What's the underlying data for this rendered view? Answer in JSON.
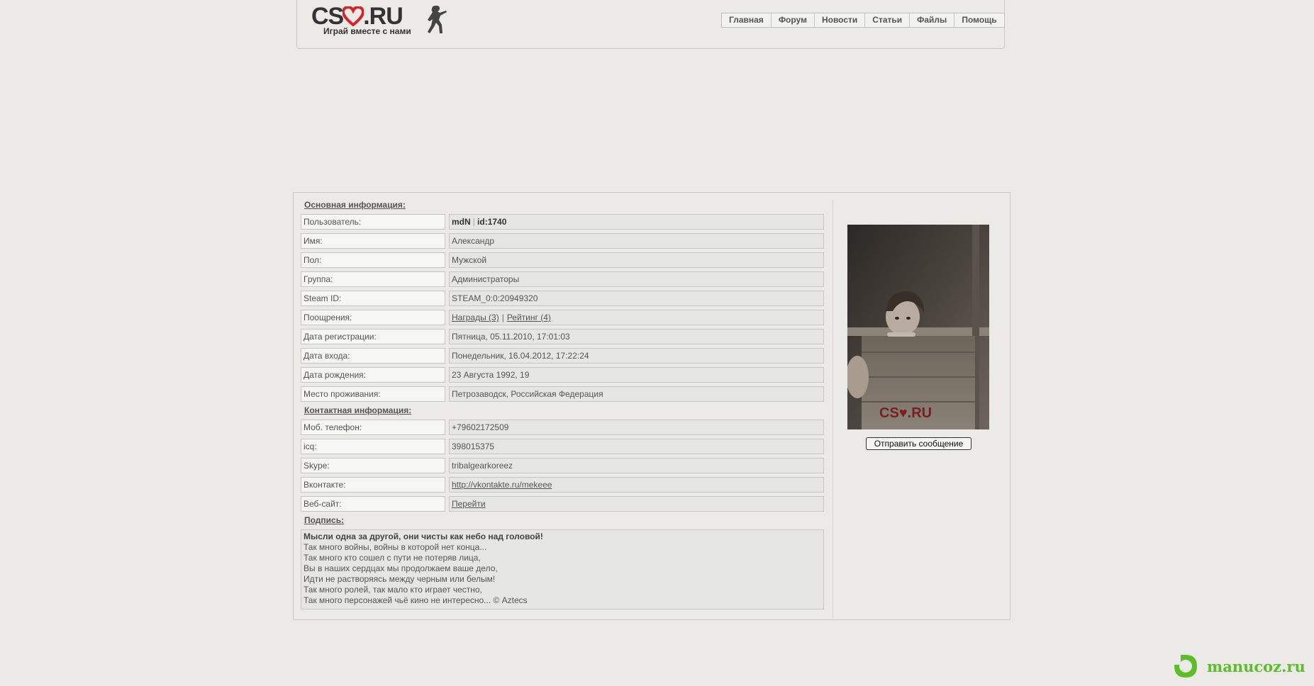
{
  "logo": {
    "title": "CS♥.RU",
    "subtitle": "Играй вместе с нами"
  },
  "nav": {
    "items": [
      "Главная",
      "Форум",
      "Новости",
      "Статьи",
      "Файлы",
      "Помощь"
    ]
  },
  "sections": {
    "main": "Основная информация:",
    "contact": "Контактная информация:",
    "signature": "Подпись:"
  },
  "profile": {
    "user": {
      "label": "Пользователь:",
      "name": "mdN",
      "id": "id:1740"
    },
    "name": {
      "label": "Имя:",
      "value": "Александр"
    },
    "gender": {
      "label": "Пол:",
      "value": "Мужской"
    },
    "group": {
      "label": "Группа:",
      "value": "Администраторы"
    },
    "steam": {
      "label": "Steam ID:",
      "value": "STEAM_0:0:20949320"
    },
    "rewards": {
      "label": "Поощрения:",
      "awards": "Награды (3)",
      "rating": "Рейтинг (4)",
      "separator": "|"
    },
    "registered": {
      "label": "Дата регистрации:",
      "value": "Пятница, 05.11.2010, 17:01:03"
    },
    "last_login": {
      "label": "Дата входа:",
      "value": "Понедельник, 16.04.2012, 17:22:24"
    },
    "birthday": {
      "label": "Дата рождения:",
      "value": "23 Августа 1992, 19"
    },
    "location": {
      "label": "Место проживания:",
      "value": "Петрозаводск, Российская Федерация"
    }
  },
  "contacts": {
    "phone": {
      "label": "Моб. телефон:",
      "value": "+79602172509"
    },
    "icq": {
      "label": "icq:",
      "value": "398015375"
    },
    "skype": {
      "label": "Skype:",
      "value": "tribalgearkoreez"
    },
    "vk": {
      "label": "Вконтакте:",
      "value": "http://vkontakte.ru/mekeee"
    },
    "website": {
      "label": "Веб-сайт:",
      "value": "Перейти"
    }
  },
  "signature_lines": [
    "Мысли одна за другой, они чисты как небо над головой!",
    "Так много войны, войны в которой нет конца...",
    "Так много кто сошел с пути не потеряв лица,",
    "Вы в наших сердцах мы продолжаем ваше дело,",
    "Идти не растворяясь между черным или белым!",
    "Так много ролей, так мало кто играет честно,",
    "Так много персонажей чьё кино не интересно... © Aztecs"
  ],
  "avatar": {
    "watermark": "CS♥.RU"
  },
  "send_message_label": "Отправить сообщение",
  "watermark": {
    "text": "manucoz.ru"
  },
  "colors": {
    "background": "#ebeae6",
    "heart": "#d8232a",
    "watermark_green": "#5cbf2a"
  }
}
